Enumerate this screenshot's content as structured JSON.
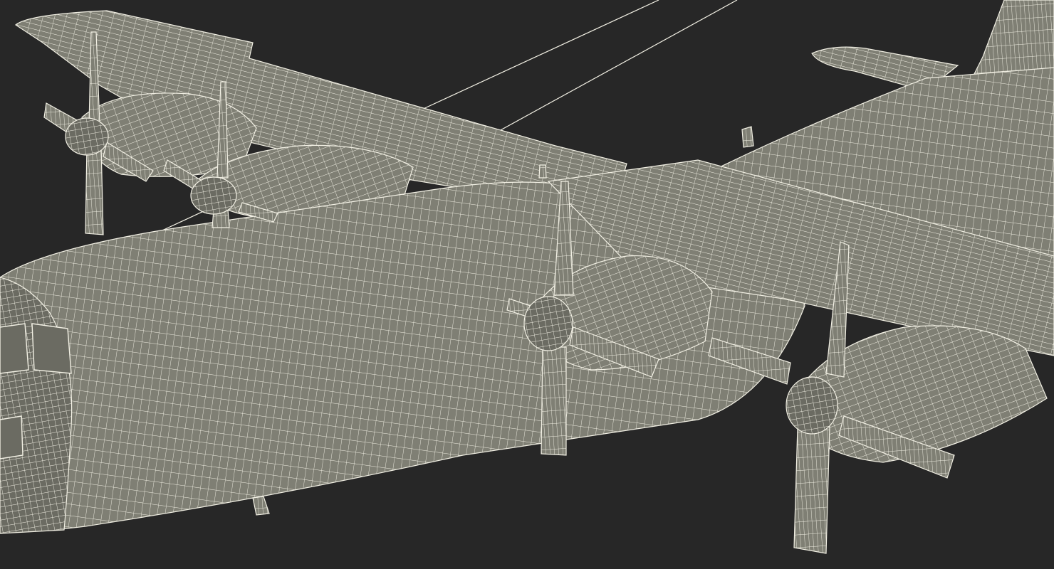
{
  "scene": {
    "subject": "aircraft-wireframe-model",
    "background_color": "#272727",
    "surface_color": "#7f7f74",
    "surface_shadow_color": "#6b6b62",
    "wire_color": "#f2f0e4"
  }
}
